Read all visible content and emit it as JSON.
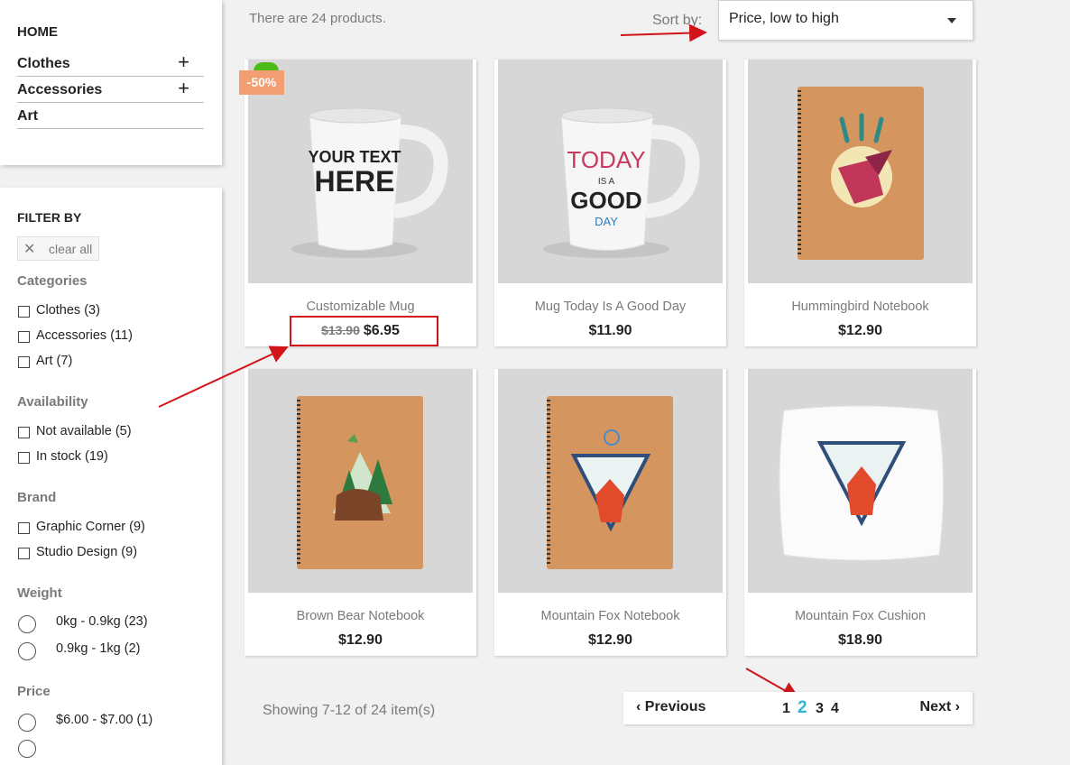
{
  "categories": {
    "home": "HOME",
    "items": [
      {
        "label": "Clothes",
        "icon": "plus-icon"
      },
      {
        "label": "Accessories",
        "icon": "plus-icon"
      },
      {
        "label": "Art"
      }
    ]
  },
  "filters": {
    "title": "FILTER BY",
    "clear_all": "clear all",
    "groups": [
      {
        "title": "Categories",
        "options": [
          "Clothes (3)",
          "Accessories (11)",
          "Art (7)"
        ]
      },
      {
        "title": "Availability",
        "options": [
          "Not available (5)",
          "In stock (19)"
        ]
      },
      {
        "title": "Brand",
        "options": [
          "Graphic Corner (9)",
          "Studio Design (9)"
        ]
      },
      {
        "title": "Weight",
        "options": [
          "0kg - 0.9kg (23)",
          "0.9kg - 1kg (2)"
        ]
      },
      {
        "title": "Price",
        "options": [
          "$6.00 - $7.00 (1)"
        ]
      }
    ]
  },
  "toolbar": {
    "count_text": "There are 24 products.",
    "sort_label": "Sort by:",
    "sort_value": "Price, low to high"
  },
  "products": [
    {
      "name": "Customizable Mug",
      "old_price": "$13.90",
      "price": "$6.95",
      "badge": "-50%",
      "mug_text": [
        "YOUR TEXT",
        "HERE"
      ]
    },
    {
      "name": "Mug Today Is A Good Day",
      "price": "$11.90",
      "mug_text": [
        "TODAY",
        "IS A",
        "GOOD",
        "DAY"
      ]
    },
    {
      "name": "Hummingbird Notebook",
      "price": "$12.90"
    },
    {
      "name": "Brown Bear Notebook",
      "price": "$12.90"
    },
    {
      "name": "Mountain Fox Notebook",
      "price": "$12.90"
    },
    {
      "name": "Mountain Fox Cushion",
      "price": "$18.90"
    }
  ],
  "pagination": {
    "showing": "Showing 7-12 of 24 item(s)",
    "previous": "Previous",
    "next": "Next",
    "pages": [
      "1",
      "2",
      "3",
      "4"
    ],
    "current": "2"
  },
  "colors": {
    "accent": "#2fb5d2",
    "discount_badge": "#f39d72",
    "annotation": "#d0141a"
  }
}
